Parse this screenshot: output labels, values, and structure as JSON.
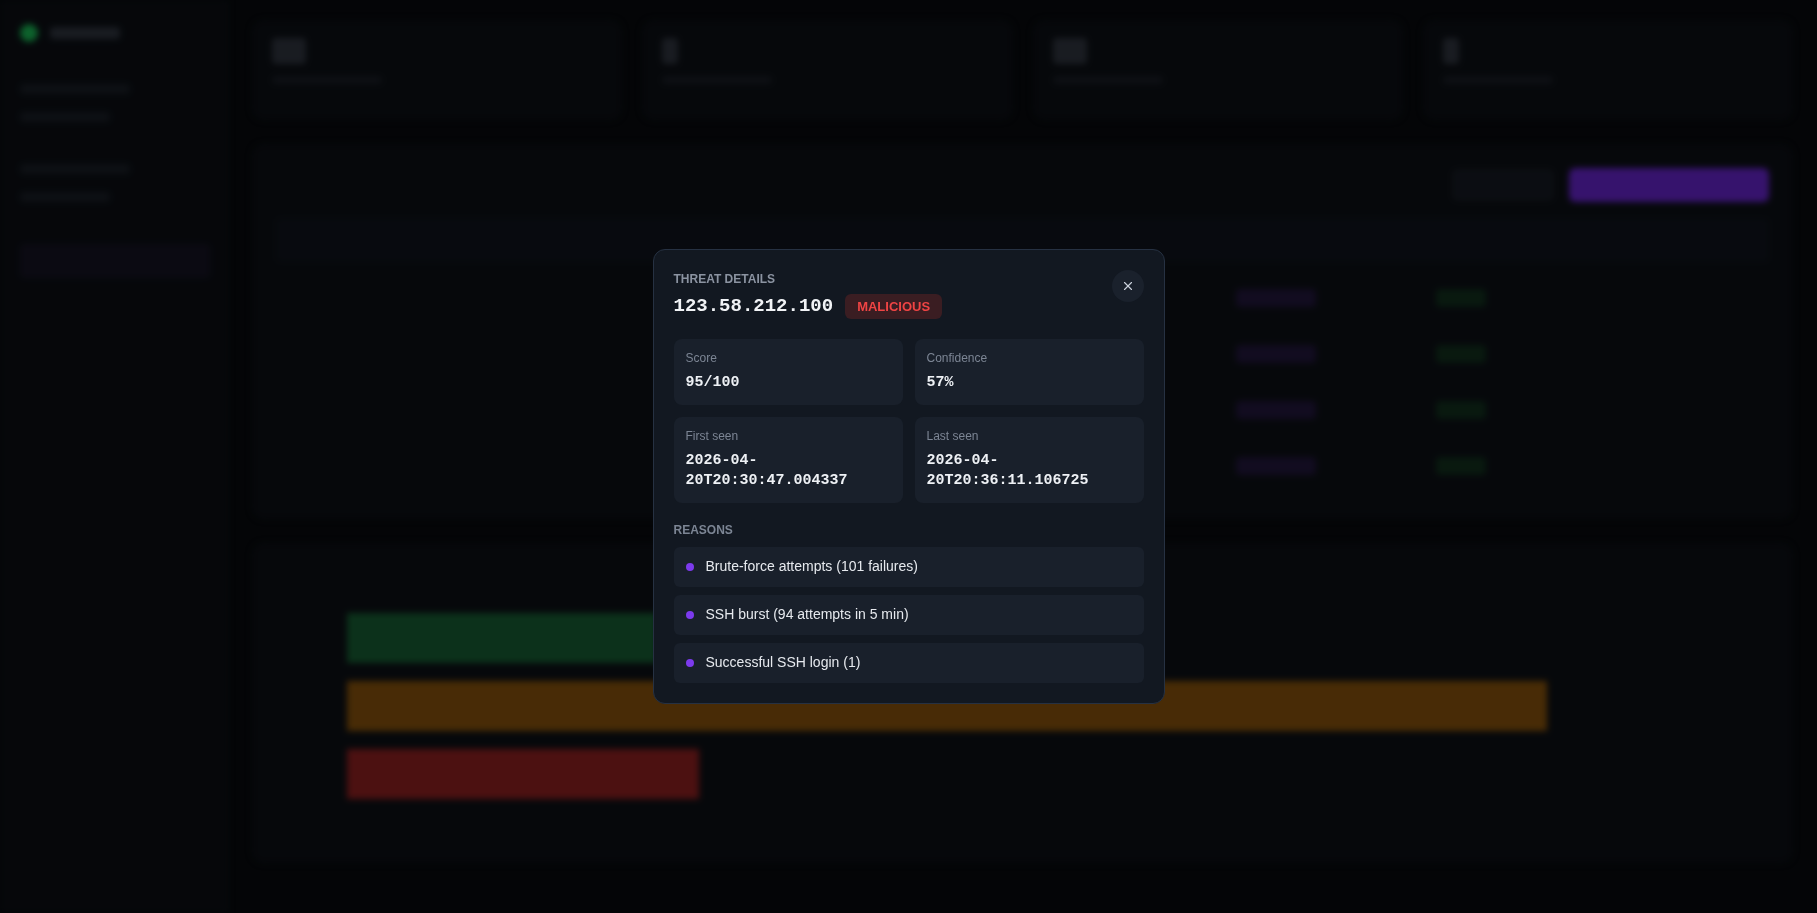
{
  "modal": {
    "heading": "THREAT DETAILS",
    "ip": "123.58.212.100",
    "verdict": {
      "label": "MALICIOUS",
      "kind": "malicious"
    },
    "metrics": [
      {
        "label": "Score",
        "value": "95/100"
      },
      {
        "label": "Confidence",
        "value": "57%"
      },
      {
        "label": "First seen",
        "value": "2026-04-20T20:30:47.004337"
      },
      {
        "label": "Last seen",
        "value": "2026-04-20T20:36:11.106725"
      }
    ],
    "reasons_heading": "REASONS",
    "reasons": [
      "Brute-force attempts (101 failures)",
      "SSH burst (94 attempts in 5 min)",
      "Successful SSH login (1)"
    ]
  }
}
